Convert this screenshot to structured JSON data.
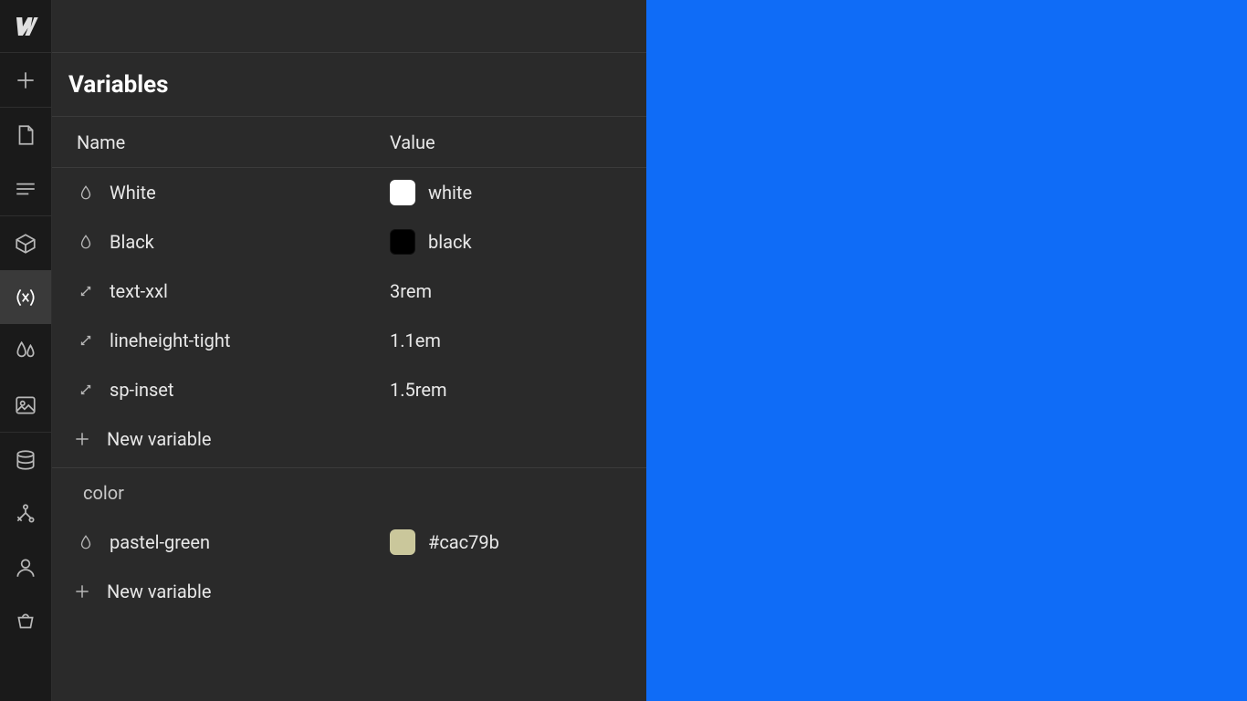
{
  "panel": {
    "title": "Variables",
    "columns": {
      "name": "Name",
      "value": "Value"
    },
    "groups": [
      {
        "title": null,
        "vars": [
          {
            "icon": "drop",
            "name": "White",
            "value": "white",
            "swatch": "#ffffff"
          },
          {
            "icon": "drop",
            "name": "Black",
            "value": "black",
            "swatch": "#000000"
          },
          {
            "icon": "size",
            "name": "text-xxl",
            "value": "3rem",
            "swatch": null
          },
          {
            "icon": "size",
            "name": "lineheight-tight",
            "value": "1.1em",
            "swatch": null
          },
          {
            "icon": "size",
            "name": "sp-inset",
            "value": "1.5rem",
            "swatch": null
          }
        ],
        "new_label": "New variable"
      },
      {
        "title": "color",
        "vars": [
          {
            "icon": "drop",
            "name": "pastel-green",
            "value": "#cac79b",
            "swatch": "#cac79b"
          }
        ],
        "new_label": "New variable"
      }
    ]
  },
  "canvas": {
    "bg": "#0f6cf7"
  },
  "rail": {
    "items": [
      {
        "id": "add",
        "group": 0
      },
      {
        "id": "page",
        "group": 1
      },
      {
        "id": "navigator",
        "group": 1
      },
      {
        "id": "components",
        "group": 2
      },
      {
        "id": "variables",
        "group": 2,
        "active": true
      },
      {
        "id": "style-guide",
        "group": 2
      },
      {
        "id": "assets",
        "group": 2
      },
      {
        "id": "cms",
        "group": 3
      },
      {
        "id": "logic",
        "group": 3
      },
      {
        "id": "users",
        "group": 3
      },
      {
        "id": "ecommerce",
        "group": 3
      }
    ]
  }
}
